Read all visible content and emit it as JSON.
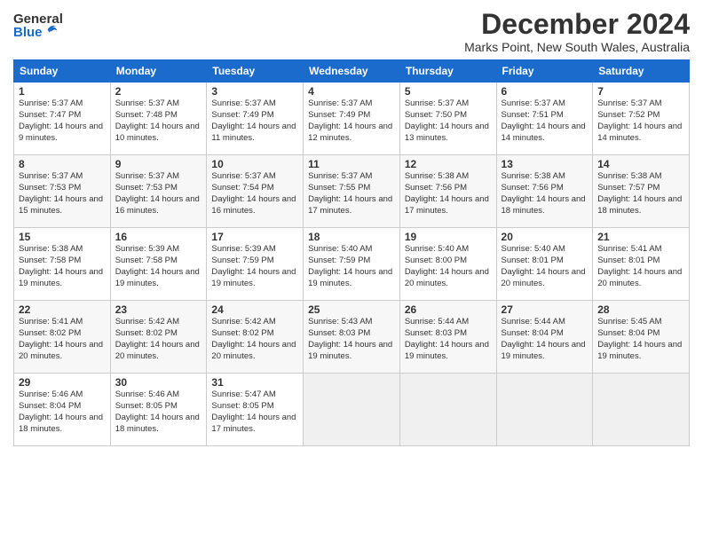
{
  "logo": {
    "general": "General",
    "blue": "Blue"
  },
  "title": "December 2024",
  "location": "Marks Point, New South Wales, Australia",
  "headers": [
    "Sunday",
    "Monday",
    "Tuesday",
    "Wednesday",
    "Thursday",
    "Friday",
    "Saturday"
  ],
  "weeks": [
    [
      {
        "day": "1",
        "sunrise": "5:37 AM",
        "sunset": "7:47 PM",
        "daylight": "14 hours and 9 minutes."
      },
      {
        "day": "2",
        "sunrise": "5:37 AM",
        "sunset": "7:48 PM",
        "daylight": "14 hours and 10 minutes."
      },
      {
        "day": "3",
        "sunrise": "5:37 AM",
        "sunset": "7:49 PM",
        "daylight": "14 hours and 11 minutes."
      },
      {
        "day": "4",
        "sunrise": "5:37 AM",
        "sunset": "7:49 PM",
        "daylight": "14 hours and 12 minutes."
      },
      {
        "day": "5",
        "sunrise": "5:37 AM",
        "sunset": "7:50 PM",
        "daylight": "14 hours and 13 minutes."
      },
      {
        "day": "6",
        "sunrise": "5:37 AM",
        "sunset": "7:51 PM",
        "daylight": "14 hours and 14 minutes."
      },
      {
        "day": "7",
        "sunrise": "5:37 AM",
        "sunset": "7:52 PM",
        "daylight": "14 hours and 14 minutes."
      }
    ],
    [
      {
        "day": "8",
        "sunrise": "5:37 AM",
        "sunset": "7:53 PM",
        "daylight": "14 hours and 15 minutes."
      },
      {
        "day": "9",
        "sunrise": "5:37 AM",
        "sunset": "7:53 PM",
        "daylight": "14 hours and 16 minutes."
      },
      {
        "day": "10",
        "sunrise": "5:37 AM",
        "sunset": "7:54 PM",
        "daylight": "14 hours and 16 minutes."
      },
      {
        "day": "11",
        "sunrise": "5:37 AM",
        "sunset": "7:55 PM",
        "daylight": "14 hours and 17 minutes."
      },
      {
        "day": "12",
        "sunrise": "5:38 AM",
        "sunset": "7:56 PM",
        "daylight": "14 hours and 17 minutes."
      },
      {
        "day": "13",
        "sunrise": "5:38 AM",
        "sunset": "7:56 PM",
        "daylight": "14 hours and 18 minutes."
      },
      {
        "day": "14",
        "sunrise": "5:38 AM",
        "sunset": "7:57 PM",
        "daylight": "14 hours and 18 minutes."
      }
    ],
    [
      {
        "day": "15",
        "sunrise": "5:38 AM",
        "sunset": "7:58 PM",
        "daylight": "14 hours and 19 minutes."
      },
      {
        "day": "16",
        "sunrise": "5:39 AM",
        "sunset": "7:58 PM",
        "daylight": "14 hours and 19 minutes."
      },
      {
        "day": "17",
        "sunrise": "5:39 AM",
        "sunset": "7:59 PM",
        "daylight": "14 hours and 19 minutes."
      },
      {
        "day": "18",
        "sunrise": "5:40 AM",
        "sunset": "7:59 PM",
        "daylight": "14 hours and 19 minutes."
      },
      {
        "day": "19",
        "sunrise": "5:40 AM",
        "sunset": "8:00 PM",
        "daylight": "14 hours and 20 minutes."
      },
      {
        "day": "20",
        "sunrise": "5:40 AM",
        "sunset": "8:01 PM",
        "daylight": "14 hours and 20 minutes."
      },
      {
        "day": "21",
        "sunrise": "5:41 AM",
        "sunset": "8:01 PM",
        "daylight": "14 hours and 20 minutes."
      }
    ],
    [
      {
        "day": "22",
        "sunrise": "5:41 AM",
        "sunset": "8:02 PM",
        "daylight": "14 hours and 20 minutes."
      },
      {
        "day": "23",
        "sunrise": "5:42 AM",
        "sunset": "8:02 PM",
        "daylight": "14 hours and 20 minutes."
      },
      {
        "day": "24",
        "sunrise": "5:42 AM",
        "sunset": "8:02 PM",
        "daylight": "14 hours and 20 minutes."
      },
      {
        "day": "25",
        "sunrise": "5:43 AM",
        "sunset": "8:03 PM",
        "daylight": "14 hours and 19 minutes."
      },
      {
        "day": "26",
        "sunrise": "5:44 AM",
        "sunset": "8:03 PM",
        "daylight": "14 hours and 19 minutes."
      },
      {
        "day": "27",
        "sunrise": "5:44 AM",
        "sunset": "8:04 PM",
        "daylight": "14 hours and 19 minutes."
      },
      {
        "day": "28",
        "sunrise": "5:45 AM",
        "sunset": "8:04 PM",
        "daylight": "14 hours and 19 minutes."
      }
    ],
    [
      {
        "day": "29",
        "sunrise": "5:46 AM",
        "sunset": "8:04 PM",
        "daylight": "14 hours and 18 minutes."
      },
      {
        "day": "30",
        "sunrise": "5:46 AM",
        "sunset": "8:05 PM",
        "daylight": "14 hours and 18 minutes."
      },
      {
        "day": "31",
        "sunrise": "5:47 AM",
        "sunset": "8:05 PM",
        "daylight": "14 hours and 17 minutes."
      },
      null,
      null,
      null,
      null
    ]
  ],
  "labels": {
    "sunrise": "Sunrise:",
    "sunset": "Sunset:",
    "daylight": "Daylight:"
  }
}
